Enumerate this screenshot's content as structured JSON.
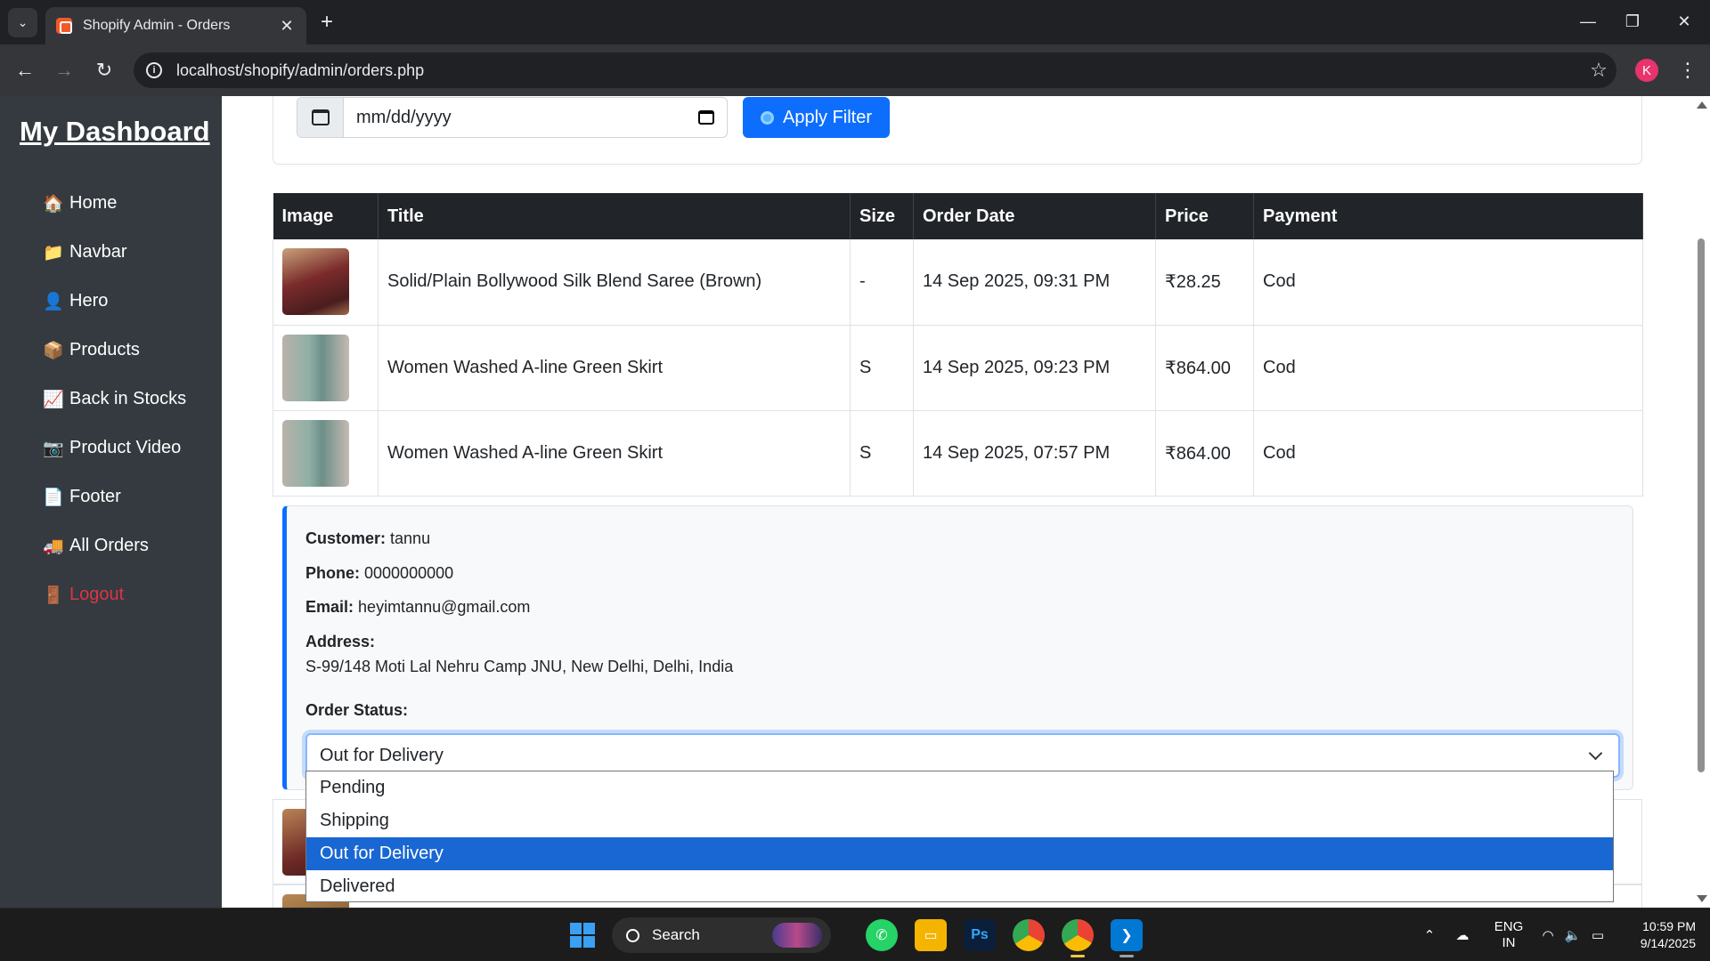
{
  "browser": {
    "tab_title": "Shopify Admin - Orders",
    "url": "localhost/shopify/admin/orders.php",
    "profile_initial": "K",
    "new_tab_symbol": "+",
    "close_symbol": "✕"
  },
  "sidebar": {
    "brand": "My Dashboard",
    "items": [
      {
        "icon": "home-icon",
        "glyph": "🏠",
        "label": "Home"
      },
      {
        "icon": "folder-icon",
        "glyph": "📁",
        "label": "Navbar"
      },
      {
        "icon": "person-icon",
        "glyph": "👤",
        "label": "Hero"
      },
      {
        "icon": "package-icon",
        "glyph": "📦",
        "label": "Products"
      },
      {
        "icon": "chart-icon",
        "glyph": "📈",
        "label": "Back in Stocks"
      },
      {
        "icon": "video-icon",
        "glyph": "📷",
        "label": "Product Video"
      },
      {
        "icon": "page-icon",
        "glyph": "📄",
        "label": "Footer"
      },
      {
        "icon": "truck-icon",
        "glyph": "🚚",
        "label": "All Orders"
      },
      {
        "icon": "door-icon",
        "glyph": "🚪",
        "label": "Logout"
      }
    ]
  },
  "filter": {
    "date_placeholder": "mm/dd/yyyy",
    "apply_label": "Apply Filter"
  },
  "table": {
    "headers": [
      "Image",
      "Title",
      "Size",
      "Order Date",
      "Price",
      "Payment"
    ],
    "rows": [
      {
        "title": "Solid/Plain Bollywood Silk Blend Saree (Brown)",
        "size": "-",
        "date": "14 Sep 2025, 09:31 PM",
        "price": "₹28.25",
        "payment": "Cod"
      },
      {
        "title": "Women Washed A-line Green Skirt",
        "size": "S",
        "date": "14 Sep 2025, 09:23 PM",
        "price": "₹864.00",
        "payment": "Cod"
      },
      {
        "title": "Women Washed A-line Green Skirt",
        "size": "S",
        "date": "14 Sep 2025, 07:57 PM",
        "price": "₹864.00",
        "payment": "Cod"
      }
    ]
  },
  "details": {
    "customer_label": "Customer:",
    "customer": "tannu",
    "phone_label": "Phone:",
    "phone": "0000000000",
    "email_label": "Email:",
    "email": "heyimtannu@gmail.com",
    "address_label": "Address:",
    "address": "S-99/148 Moti Lal Nehru Camp JNU, New Delhi, Delhi, India",
    "status_label": "Order Status:",
    "status_value": "Out for Delivery",
    "status_options": [
      "Pending",
      "Shipping",
      "Out for Delivery",
      "Delivered"
    ]
  },
  "taskbar": {
    "search_label": "Search",
    "lang_top": "ENG",
    "lang_bottom": "IN",
    "time": "10:59 PM",
    "date": "9/14/2025"
  },
  "colors": {
    "sidebar_bg": "#343a40",
    "primary": "#0d6efd",
    "logout": "#dc3545",
    "table_header": "#212529",
    "selected_option": "#1967d2"
  }
}
